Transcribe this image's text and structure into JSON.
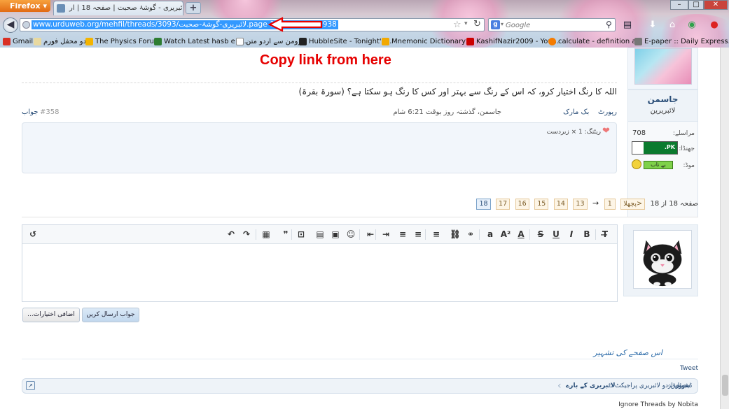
{
  "browser": {
    "app_button": "Firefox",
    "tab_title": "لائبریری - گوشۂ صحبت | صفحہ 18 | ار",
    "new_tab": "+",
    "window_controls": [
      "–",
      "□",
      "✕"
    ],
    "url": "www.urduweb.org/mehfil/threads/3093/لائبریری-گوشۂ-صحبت.page-18#post-1539938",
    "search_placeholder": "Google",
    "bookmarks": [
      {
        "label": "Gmail",
        "icon": "gmail-icon",
        "color": "#d93025"
      },
      {
        "label": "اردو محفل فورم",
        "icon": "forum-icon",
        "color": "#e8d9a0"
      },
      {
        "label": "The Physics Forum",
        "icon": "physics-icon",
        "color": "#f4b400"
      },
      {
        "label": "Watch Latest hasb e h...",
        "icon": "video-icon",
        "color": "#2e7d32"
      },
      {
        "label": "رومن سے اردو متن",
        "icon": "page-icon",
        "color": "#ffffff"
      },
      {
        "label": "HubbleSite - Tonight's...",
        "icon": "hubble-icon",
        "color": "#222222"
      },
      {
        "label": "Mnemonic Dictionary ...",
        "icon": "mnemonic-icon",
        "color": "#f2a900"
      },
      {
        "label": "KashifNazir2009 - You...",
        "icon": "youtube-icon",
        "color": "#cc0000"
      },
      {
        "label": "calculate - definition a...",
        "icon": "heart-icon",
        "color": "#f57c00"
      },
      {
        "label": "E-paper :: Daily Express...",
        "icon": "epaper-icon",
        "color": "#777777"
      }
    ]
  },
  "annotation": {
    "text": "Copy link from here",
    "color": "#e60000"
  },
  "post": {
    "author": "جاسمن",
    "author_title": "لائبریرین",
    "stats": [
      {
        "label": "مراسلے:",
        "value": "708"
      },
      {
        "label": "جھنڈا:",
        "value": ".PK"
      },
      {
        "label": "موڈ:",
        "value": "بے تاب"
      }
    ],
    "signature": "اللہ کا رنگ اختیار کرو، کہ اس کے رنگ سے بہتر اور کس کا رنگ ہو سکتا ہے؟ (سورۃ بقرۃ)",
    "info": "جاسمن، گذشتہ روز بوقت 6:21 شام",
    "report": "رپورٹ",
    "bookmark": "بک مارک",
    "number": "#358",
    "reply": "جواب",
    "likes_text": "ریٹنگ: 1 × زبردست"
  },
  "pager": {
    "label": "صفحہ 18 از 18",
    "prev": "<پچھلا",
    "pages": [
      "1",
      "→",
      "13",
      "14",
      "15",
      "16",
      "17",
      "18"
    ],
    "current": "18"
  },
  "editor": {
    "toolbar_icons": [
      "clear-format-icon",
      "bold-icon",
      "italic-icon",
      "underline-icon",
      "strikethrough-icon",
      "font-color-icon",
      "font-size-icon",
      "font-family-icon",
      "link-icon",
      "unlink-icon",
      "align-left-icon",
      "align-center-icon",
      "align-right-icon",
      "indent-icon",
      "outdent-icon",
      "smilie-icon",
      "image-icon",
      "media-icon",
      "code-icon",
      "quote-icon",
      "save-icon",
      "redo-icon",
      "undo-icon",
      "bbcode-icon"
    ],
    "toolbar_glyphs": [
      "T̶",
      "B",
      "I",
      "U",
      "S",
      "A",
      "A²",
      "a",
      "⚭",
      "⛓",
      "≡",
      "≡",
      "≡",
      "⇥",
      "⇤",
      "☺",
      "▣",
      "▤",
      "⊡",
      "❞",
      "▦",
      "↷",
      "↶",
      "↺"
    ],
    "submit": "جواب ارسال کریں",
    "more_options": "اضافی اختیارات..."
  },
  "footer": {
    "share_title": "اس صفحے کی تشہیر",
    "tweet": "Tweet",
    "breadcrumb": [
      "سرورق",
      "فورم",
      "ڈیجیٹل اردو لائبریری پراجیکٹ",
      "لائبریری کے بارے"
    ],
    "ignore": "Ignore Threads by Nobita"
  }
}
